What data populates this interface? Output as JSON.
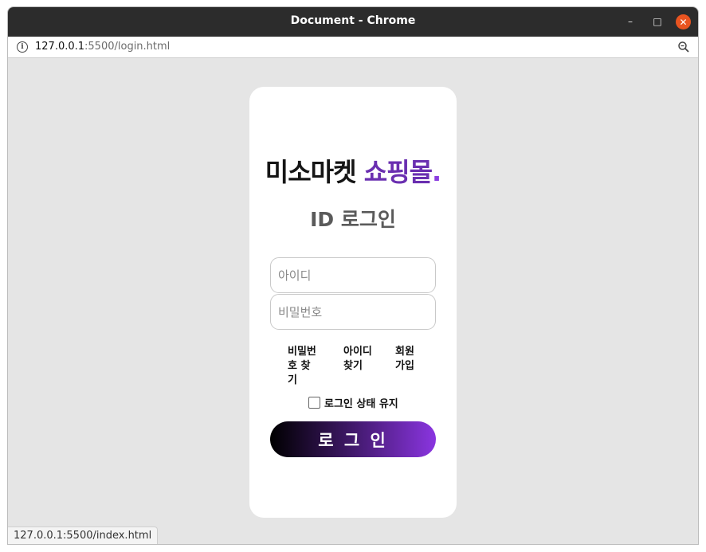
{
  "window": {
    "title": "Document - Chrome",
    "minimize_label": "–",
    "maximize_label": "□",
    "close_label": "✕"
  },
  "address_bar": {
    "url_host": "127.0.0.1",
    "url_rest": ":5500/login.html",
    "info_icon": "info-icon",
    "zoom_icon": "zoom-icon"
  },
  "login": {
    "brand_part1": "미소마켓 ",
    "brand_part2": "쇼핑몰",
    "brand_dot": ".",
    "subtitle": "ID 로그인",
    "id_placeholder": "아이디",
    "pw_placeholder": "비밀번호",
    "links": {
      "find_password": "비밀번 호 찾기",
      "find_id": "아이디 찾기",
      "signup": "회원 가입"
    },
    "keep_login_label": "로그인 상태 유지",
    "submit_label": "로 그 인"
  },
  "status_bar": {
    "text": "127.0.0.1:5500/index.html"
  },
  "colors": {
    "brand_dark": "#151515",
    "brand_purple": "#6a2fb0",
    "brand_accent": "#8b3ee0",
    "subtitle_gray": "#5a5a5a",
    "page_bg": "#e5e5e5"
  }
}
